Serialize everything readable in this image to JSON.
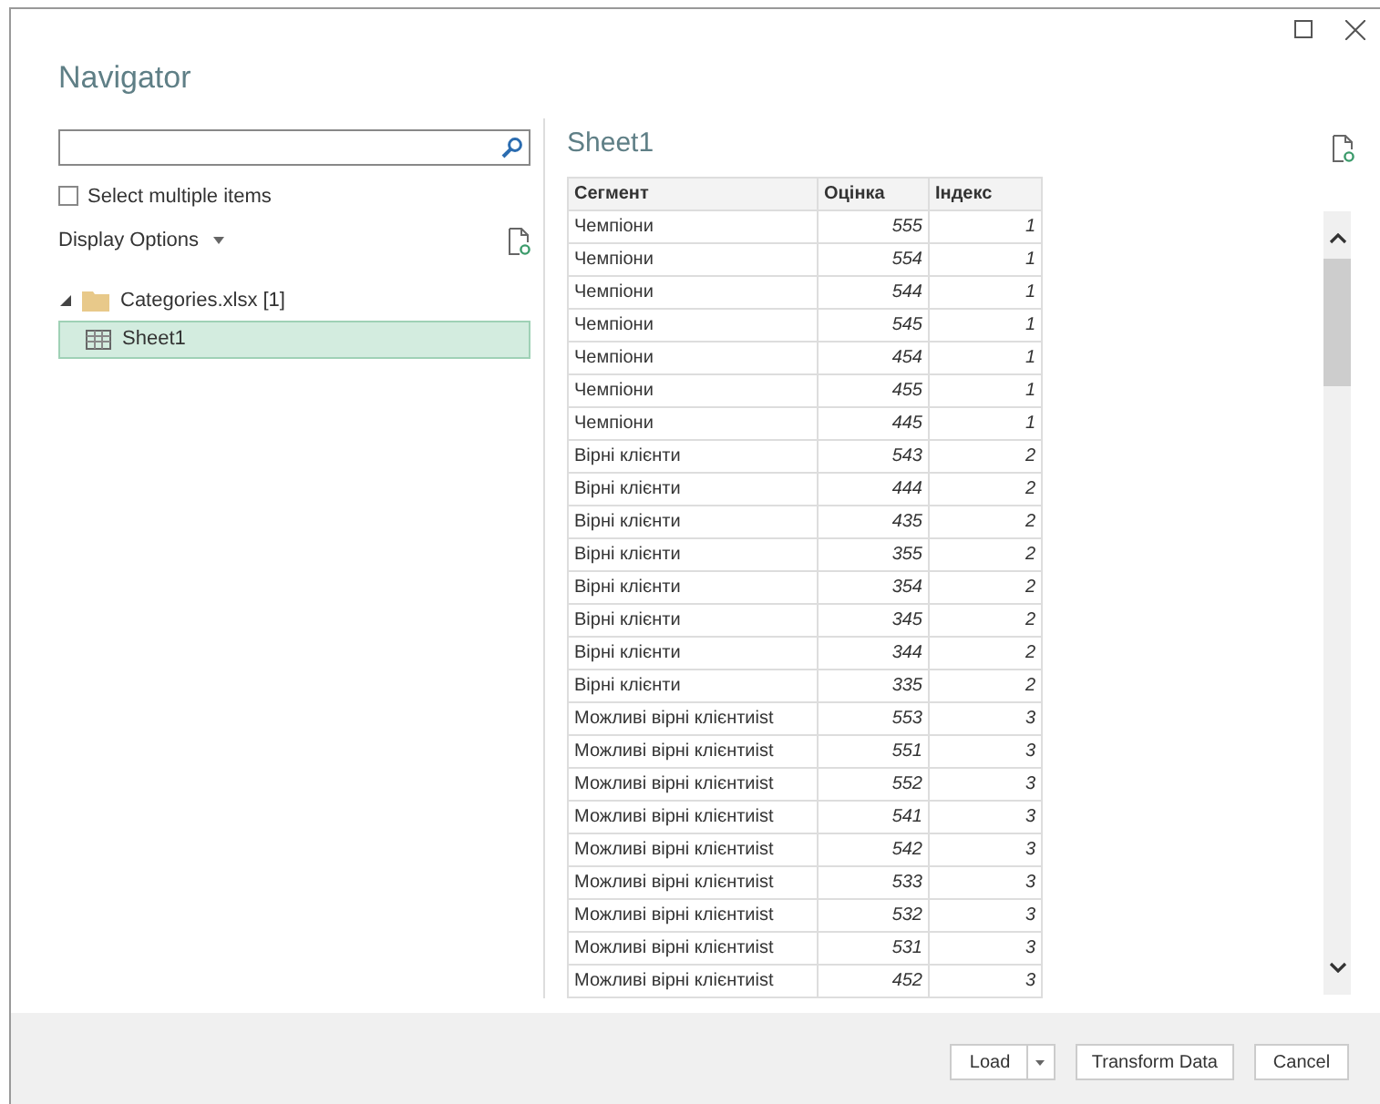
{
  "window": {
    "title": "Navigator"
  },
  "select_multiple": {
    "label": "Select multiple items",
    "checked": false
  },
  "display_options": {
    "label": "Display Options"
  },
  "tree": [
    {
      "label": "Categories.xlsx [1]",
      "kind": "folder",
      "expanded": true,
      "children": [
        {
          "label": "Sheet1",
          "kind": "sheet",
          "selected": true
        }
      ]
    }
  ],
  "preview": {
    "title": "Sheet1",
    "table": {
      "columns": [
        "Сегмент",
        "Оцінка",
        "Індекс"
      ],
      "rows": [
        [
          "Чемпіони",
          "555",
          "1"
        ],
        [
          "Чемпіони",
          "554",
          "1"
        ],
        [
          "Чемпіони",
          "544",
          "1"
        ],
        [
          "Чемпіони",
          "545",
          "1"
        ],
        [
          "Чемпіони",
          "454",
          "1"
        ],
        [
          "Чемпіони",
          "455",
          "1"
        ],
        [
          "Чемпіони",
          "445",
          "1"
        ],
        [
          "Вірні клієнти",
          "543",
          "2"
        ],
        [
          "Вірні клієнти",
          "444",
          "2"
        ],
        [
          "Вірні клієнти",
          "435",
          "2"
        ],
        [
          "Вірні клієнти",
          "355",
          "2"
        ],
        [
          "Вірні клієнти",
          "354",
          "2"
        ],
        [
          "Вірні клієнти",
          "345",
          "2"
        ],
        [
          "Вірні клієнти",
          "344",
          "2"
        ],
        [
          "Вірні клієнти",
          "335",
          "2"
        ],
        [
          "Можливі вірні клієнтиіst",
          "553",
          "3"
        ],
        [
          "Можливі вірні клієнтиіst",
          "551",
          "3"
        ],
        [
          "Можливі вірні клієнтиіst",
          "552",
          "3"
        ],
        [
          "Можливі вірні клієнтиіst",
          "541",
          "3"
        ],
        [
          "Можливі вірні клієнтиіst",
          "542",
          "3"
        ],
        [
          "Можливі вірні клієнтиіst",
          "533",
          "3"
        ],
        [
          "Можливі вірні клієнтиіst",
          "532",
          "3"
        ],
        [
          "Можливі вірні клієнтиіst",
          "531",
          "3"
        ],
        [
          "Можливі вірні клієнтиіst",
          "452",
          "3"
        ]
      ]
    }
  },
  "buttons": [
    {
      "label": "Load",
      "kind": "split"
    },
    {
      "label": "Transform Data",
      "kind": "plain"
    },
    {
      "label": "Cancel",
      "kind": "plain"
    }
  ]
}
